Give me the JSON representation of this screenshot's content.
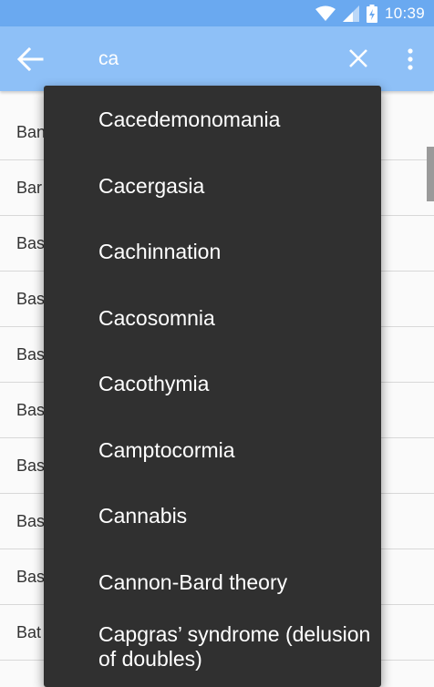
{
  "status": {
    "time": "10:39"
  },
  "toolbar": {
    "query": "ca"
  },
  "background_rows": [
    "Ban",
    "Bar",
    "Bas",
    "Bas",
    "Bas",
    "Bas",
    "Bas",
    "Bas",
    "Bas",
    "Bat"
  ],
  "suggestions": [
    "Cacedemonomania",
    "Cacergasia",
    "Cachinnation",
    "Cacosomnia",
    "Cacothymia",
    "Camptocormia",
    "Cannabis",
    "Cannon-Bard theory",
    "Capgras’ syndrome (delusion of doubles)"
  ],
  "colors": {
    "statusbar": "#6aa9f0",
    "toolbar": "#8ec0f7",
    "dropdown": "#303030"
  },
  "icons": [
    "wifi-icon",
    "signal-icon",
    "battery-icon",
    "back-arrow-icon",
    "close-icon",
    "more-vert-icon"
  ]
}
